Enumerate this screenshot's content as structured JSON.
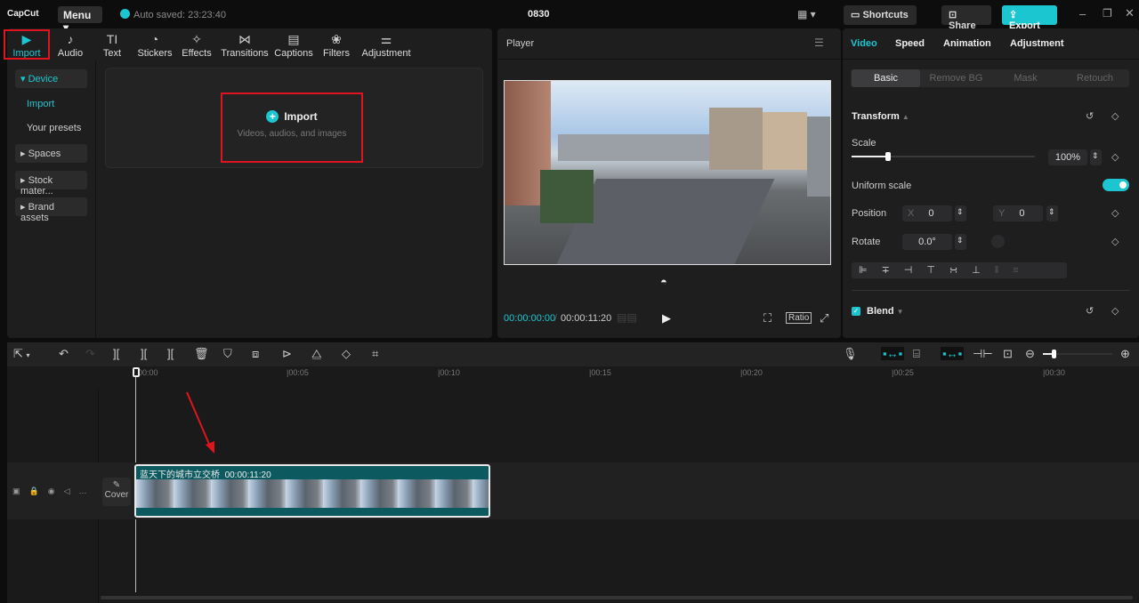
{
  "app": {
    "logo": "CapCut",
    "menu": "Menu",
    "autosave": "Auto saved: 23:23:40",
    "project_title": "0830",
    "shortcuts": "Shortcuts",
    "share": "Share",
    "export": "Export"
  },
  "toolbar": [
    {
      "label": "Import",
      "icon": "▶"
    },
    {
      "label": "Audio",
      "icon": "♪"
    },
    {
      "label": "Text",
      "icon": "TI"
    },
    {
      "label": "Stickers",
      "icon": "◔"
    },
    {
      "label": "Effects",
      "icon": "✧"
    },
    {
      "label": "Transitions",
      "icon": "⋈"
    },
    {
      "label": "Captions",
      "icon": "▤"
    },
    {
      "label": "Filters",
      "icon": "❀"
    },
    {
      "label": "Adjustment",
      "icon": "⚌"
    }
  ],
  "sidebar": [
    {
      "label": "▾ Device"
    },
    {
      "label": "Import"
    },
    {
      "label": "Your presets"
    },
    {
      "label": "▸ Spaces"
    },
    {
      "label": "▸ Stock mater..."
    },
    {
      "label": "▸ Brand assets"
    }
  ],
  "import_box": {
    "title": "Import",
    "subtitle": "Videos, audios, and images"
  },
  "player": {
    "title": "Player",
    "current_time": "00:00:00:00",
    "total_time": "00:00:11:20",
    "ratio": "Ratio"
  },
  "right_panel": {
    "tabs": [
      "Video",
      "Speed",
      "Animation",
      "Adjustment"
    ],
    "subtabs": [
      "Basic",
      "Remove BG",
      "Mask",
      "Retouch"
    ],
    "transform": "Transform",
    "scale_label": "Scale",
    "scale_value": "100%",
    "scale_fraction": 0.2,
    "uniform_scale": "Uniform scale",
    "uniform_on": true,
    "position_label": "Position",
    "x_label": "X",
    "x_value": "0",
    "y_label": "Y",
    "y_value": "0",
    "rotate_label": "Rotate",
    "rotate_value": "0.0°",
    "blend": "Blend"
  },
  "timeline": {
    "ticks": [
      "00:00",
      "|00:05",
      "|00:10",
      "|00:15",
      "|00:20",
      "|00:25",
      "|00:30"
    ],
    "cover": "Cover",
    "clip_name": "蓝天下的城市立交桥",
    "clip_duration": "00:00:11:20"
  },
  "colors": {
    "accent": "#1cc6d0",
    "highlight": "#e0141e",
    "clip": "#0c5a5f"
  }
}
